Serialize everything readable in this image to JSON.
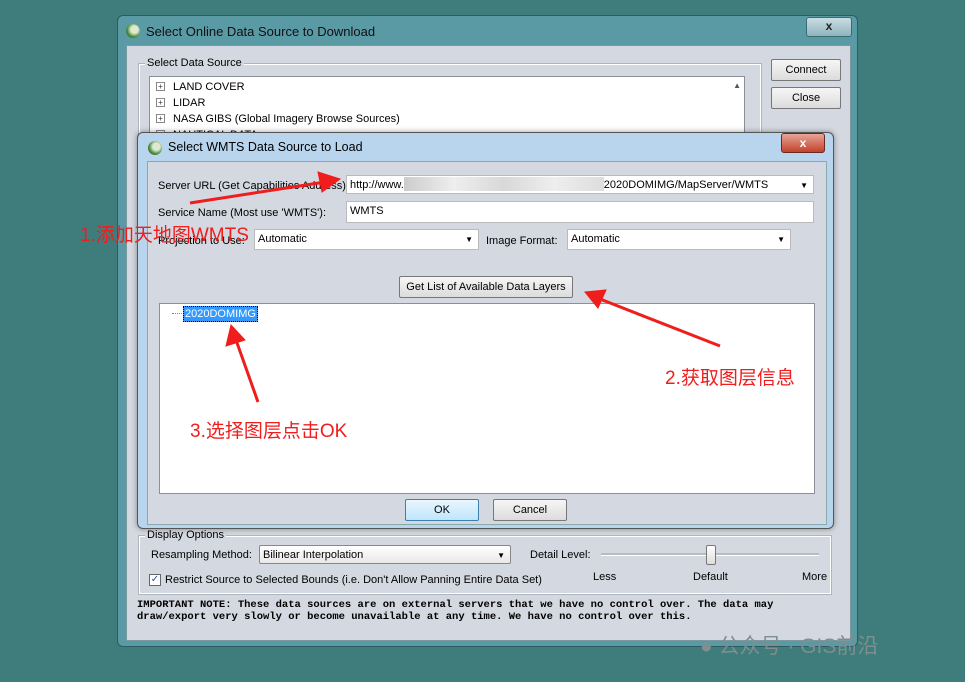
{
  "outer": {
    "title": "Select Online Data Source to Download",
    "close": "x",
    "connect": "Connect",
    "close_btn": "Close",
    "group_label": "Select Data Source",
    "sources": [
      "LAND COVER",
      "LIDAR",
      "NASA GIBS (Global Imagery Browse Sources)",
      "NAUTICAL DATA"
    ],
    "display_options": "Display Options",
    "resampling_label": "Resampling Method:",
    "resampling_value": "Bilinear Interpolation",
    "detail_label": "Detail Level:",
    "detail_less": "Less",
    "detail_default": "Default",
    "detail_more": "More",
    "detail_level_fraction": 0.5,
    "restrict_label": "Restrict Source to Selected Bounds (i.e. Don't Allow Panning Entire Data Set)",
    "restrict_checked": true,
    "note_line1": "IMPORTANT NOTE: These data sources are on external servers that we have no control over. The data may",
    "note_line2": "draw/export very slowly or become unavailable at any time. We have no control over this."
  },
  "inner": {
    "title": "Select WMTS Data Source to Load",
    "close": "x",
    "server_url_label": "Server URL (Get Capabilities Address):",
    "server_url_prefix": "http://www.",
    "server_url_suffix": "2020DOMIMG/MapServer/WMTS",
    "service_label": "Service Name (Most use 'WMTS'):",
    "service_value": "WMTS",
    "projection_label": "Projection to Use:",
    "projection_value": "Automatic",
    "format_label": "Image Format:",
    "format_value": "Automatic",
    "get_layers": "Get List of Available Data Layers",
    "layers": [
      "2020DOMIMG"
    ],
    "ok": "OK",
    "cancel": "Cancel"
  },
  "annotations": {
    "a1": "1.添加天地图WMTS",
    "a2": "2.获取图层信息",
    "a3": "3.选择图层点击OK",
    "color": "#f01d1d"
  },
  "watermark": "公众号 · GIS前沿"
}
